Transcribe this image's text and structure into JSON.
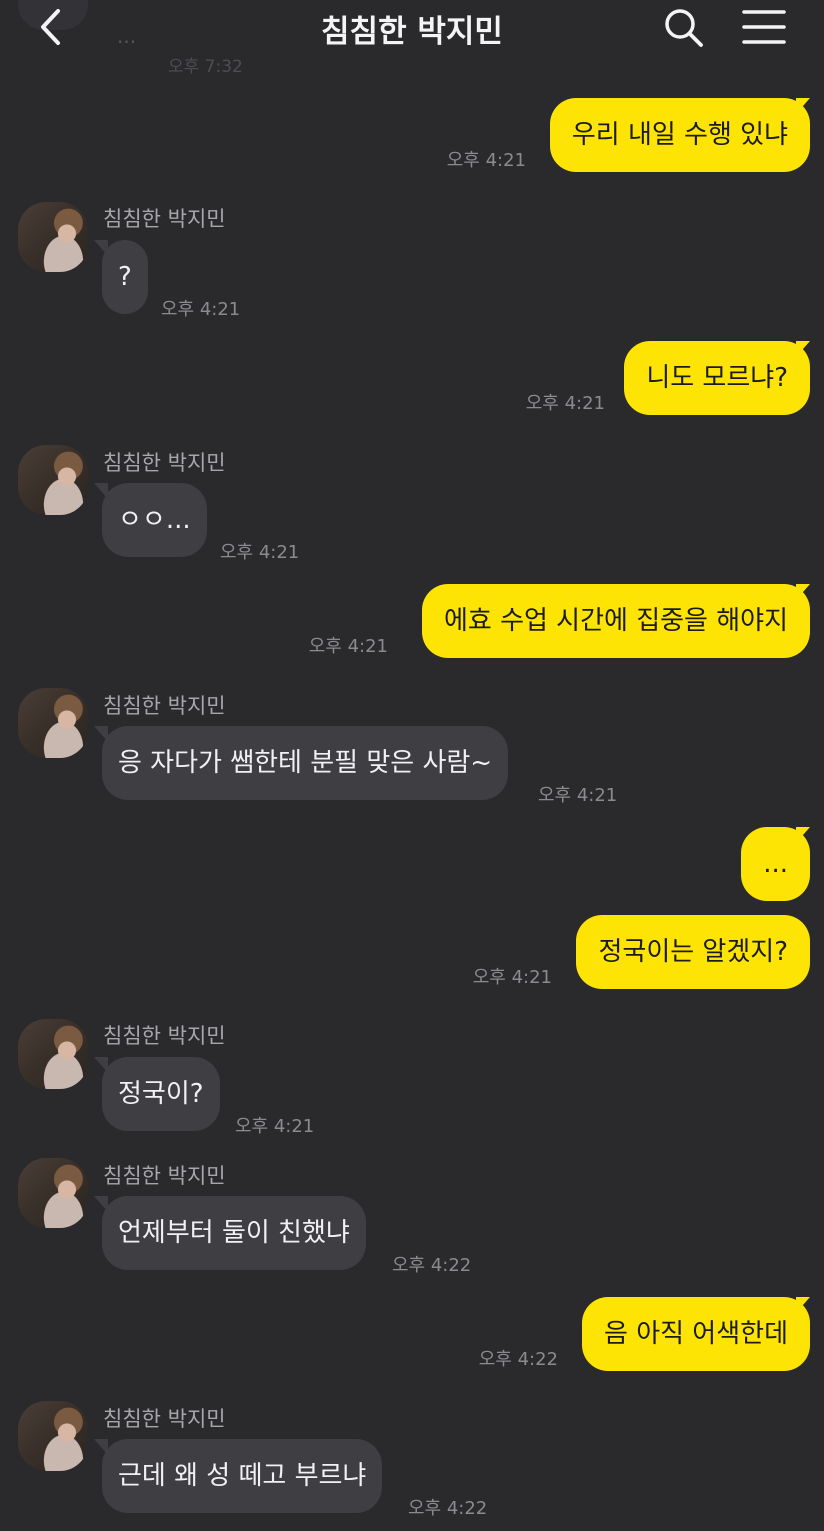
{
  "header": {
    "title": "침침한 박지민",
    "ghost_preview_text": "...",
    "ghost_preview_time": "오후 7:32"
  },
  "messages": [
    {
      "from": "me",
      "text": "우리 내일 수행 있냐",
      "time": "오후 4:21"
    },
    {
      "from": "them",
      "sender": "침침한 박지민",
      "text": "?",
      "time": "오후 4:21"
    },
    {
      "from": "me",
      "text": "니도 모르냐?",
      "time": "오후 4:21"
    },
    {
      "from": "them",
      "sender": "침침한 박지민",
      "text": "ㅇㅇ...",
      "time": "오후 4:21"
    },
    {
      "from": "me",
      "text": "에효 수업 시간에 집중을 해야지",
      "time": "오후 4:21"
    },
    {
      "from": "them",
      "sender": "침침한 박지민",
      "text": "응 자다가 쌤한테 분필 맞은 사람~",
      "time": "오후 4:21"
    },
    {
      "from": "me",
      "text": "...",
      "time": ""
    },
    {
      "from": "me",
      "text": "정국이는 알겠지?",
      "time": "오후 4:21"
    },
    {
      "from": "them",
      "sender": "침침한 박지민",
      "text": "정국이?",
      "time": "오후 4:21"
    },
    {
      "from": "them",
      "sender": "침침한 박지민",
      "text": "언제부터 둘이 친했냐",
      "time": "오후 4:22"
    },
    {
      "from": "me",
      "text": "음 아직 어색한데",
      "time": "오후 4:22"
    },
    {
      "from": "them",
      "sender": "침침한 박지민",
      "text": "근데 왜 성 떼고 부르냐",
      "time": "오후 4:22"
    }
  ],
  "colors": {
    "background": "#2a2a2d",
    "my_bubble": "#fde404",
    "their_bubble": "#3f3f43"
  },
  "icons": [
    "back-chevron-icon",
    "search-icon",
    "hamburger-menu-icon"
  ]
}
